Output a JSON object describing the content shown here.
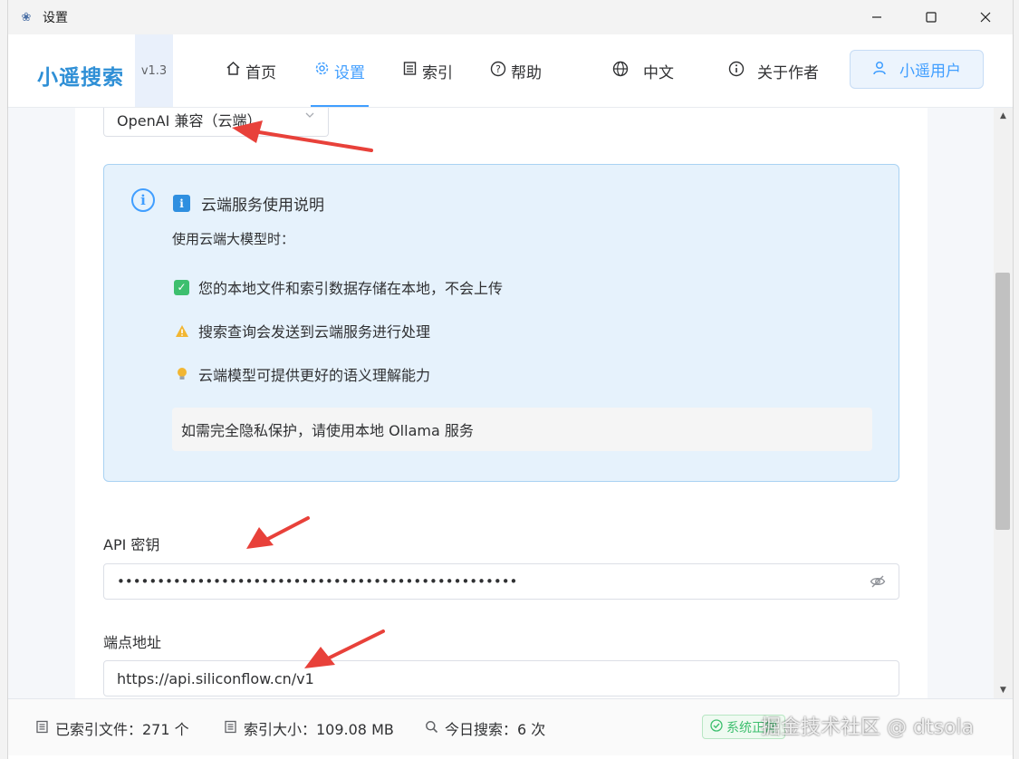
{
  "window": {
    "title": "设置",
    "minimize": "—",
    "maximize": "☐",
    "close": "✕"
  },
  "header": {
    "brand": "小遥搜索",
    "version": "v1.3",
    "nav": [
      {
        "label": "首页",
        "icon": "home-icon"
      },
      {
        "label": "设置",
        "icon": "gear-icon",
        "active": true
      },
      {
        "label": "索引",
        "icon": "list-icon"
      },
      {
        "label": "帮助",
        "icon": "help-icon"
      },
      {
        "label": "中文",
        "icon": "globe-icon"
      },
      {
        "label": "关于作者",
        "icon": "info-icon"
      }
    ],
    "user_button": "小遥用户"
  },
  "settings": {
    "provider_select": "OpenAI 兼容（云端）",
    "info": {
      "title": "云端服务使用说明",
      "intro": "使用云端大模型时：",
      "bullets": [
        "您的本地文件和索引数据存储在本地，不会上传",
        "搜索查询会发送到云端服务进行处理",
        "云端模型可提供更好的语义理解能力"
      ],
      "note": "如需完全隐私保护，请使用本地 Ollama 服务"
    },
    "api_key_label": "API 密钥",
    "api_key_value": "••••••••••••••••••••••••••••••••••••••••••••••••••",
    "endpoint_label": "端点地址",
    "endpoint_value": "https://api.siliconflow.cn/v1"
  },
  "status": {
    "indexed_files": "已索引文件：271 个",
    "index_size": "索引大小：109.08 MB",
    "today_searches": "今日搜索：6 次",
    "system_status": "系统正常"
  },
  "watermark": "掘金技术社区 @ dtsola",
  "colors": {
    "accent": "#409eff",
    "brand": "#2e8fd6",
    "info_bg": "#e6f2fc",
    "success": "#3dbf6e",
    "annotation_arrow": "#e8413a"
  }
}
